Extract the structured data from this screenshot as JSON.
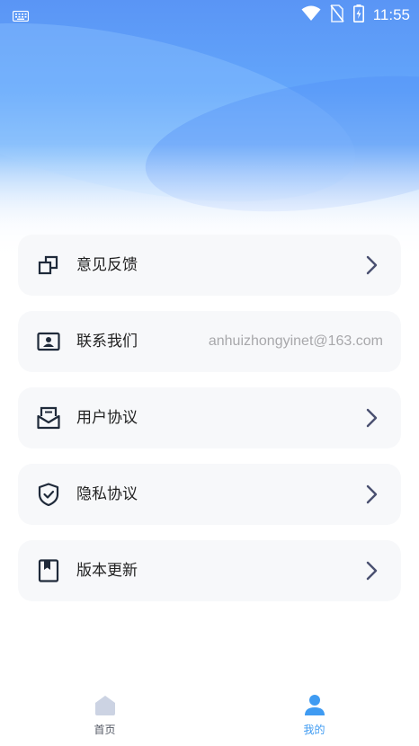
{
  "status_bar": {
    "time": "11:55",
    "left_icon": "keyboard-icon",
    "right_icons": [
      "wifi-icon",
      "no-sim-icon",
      "battery-charging-icon"
    ]
  },
  "menu": {
    "items": [
      {
        "label": "意见反馈",
        "icon": "feedback-icon",
        "trailing": "chevron-right-icon"
      },
      {
        "label": "联系我们",
        "icon": "contact-card-icon",
        "value": "anhuizhongyinet@163.com"
      },
      {
        "label": "用户协议",
        "icon": "envelope-icon",
        "trailing": "chevron-right-icon"
      },
      {
        "label": "隐私协议",
        "icon": "shield-check-icon",
        "trailing": "chevron-right-icon"
      },
      {
        "label": "版本更新",
        "icon": "bookmark-icon",
        "trailing": "chevron-right-icon"
      }
    ]
  },
  "tabbar": {
    "tabs": [
      {
        "label": "首页",
        "icon": "home-icon",
        "active": false
      },
      {
        "label": "我的",
        "icon": "user-icon",
        "active": true
      }
    ]
  },
  "colors": {
    "accent": "#3f9bf2",
    "icon_dark": "#1f2a3a",
    "chevron": "#4a5070",
    "card_bg": "#f7f8fa"
  }
}
